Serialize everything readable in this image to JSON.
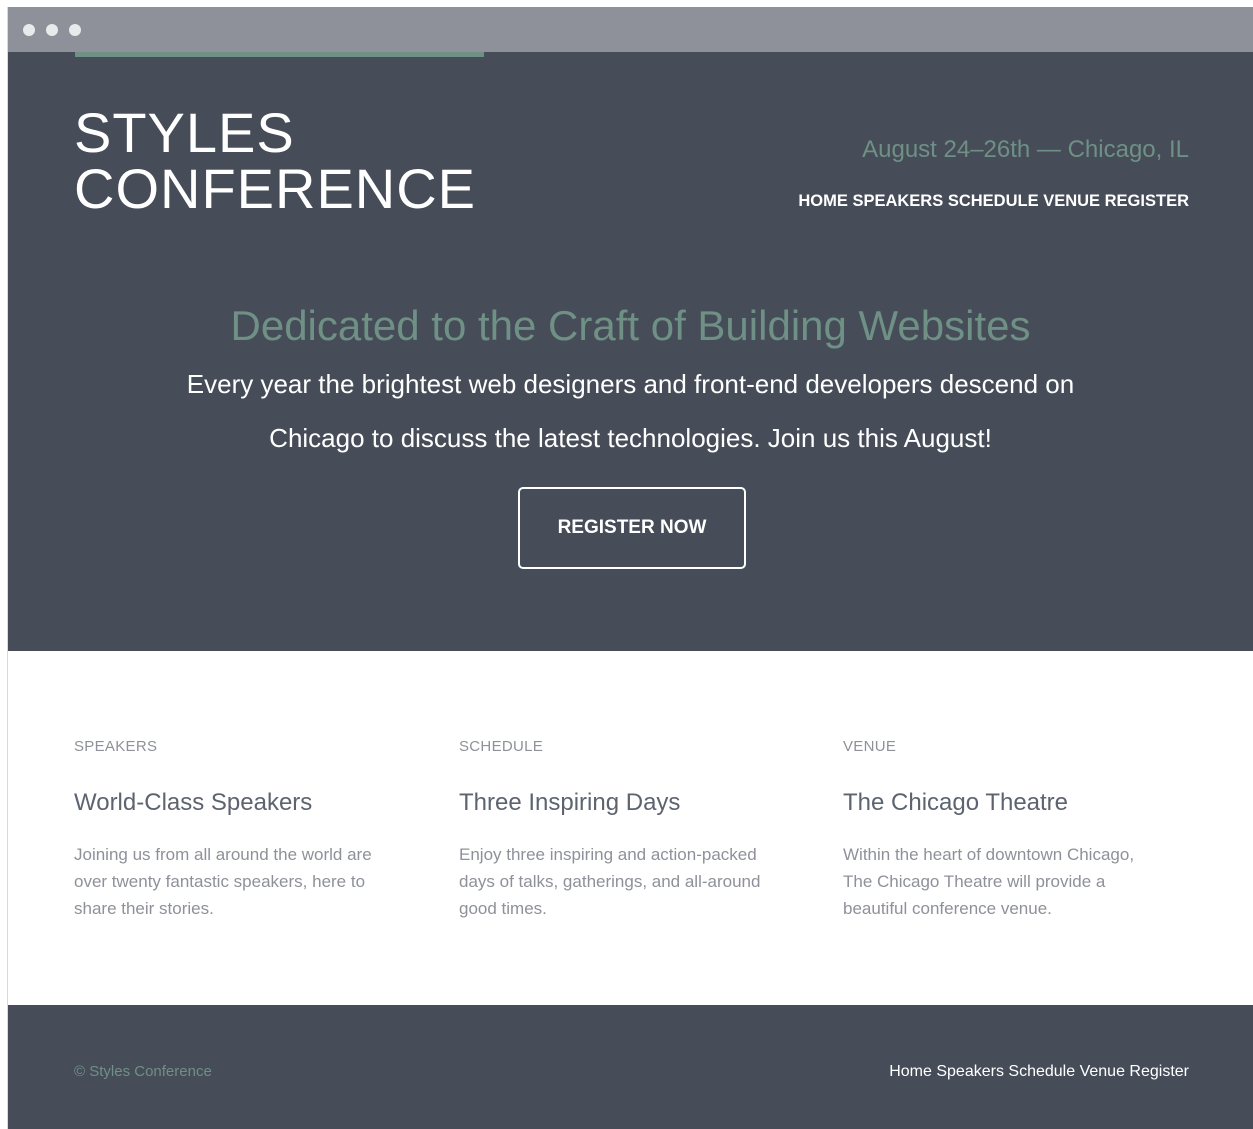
{
  "header": {
    "logo_line1": "STYLES",
    "logo_line2": "CONFERENCE",
    "tagline": "August 24–26th — Chicago, IL",
    "nav": [
      "HOME",
      "SPEAKERS",
      "SCHEDULE",
      "VENUE",
      "REGISTER"
    ]
  },
  "hero": {
    "title": "Dedicated to the Craft of Building Websites",
    "text_line1": "Every year the brightest web designers and front-end developers descend on",
    "text_line2": "Chicago to discuss the latest technologies. Join us this August!",
    "cta_label": "REGISTER NOW"
  },
  "features": [
    {
      "label": "SPEAKERS",
      "heading": "World-Class Speakers",
      "body": [
        "Joining us from all around the world are",
        "over twenty fantastic speakers, here to",
        "share their stories."
      ]
    },
    {
      "label": "SCHEDULE",
      "heading": "Three Inspiring Days",
      "body": [
        "Enjoy three inspiring and action-packed",
        "days of talks, gatherings, and all-around",
        "good times."
      ]
    },
    {
      "label": "VENUE",
      "heading": "The Chicago Theatre",
      "body": [
        "Within the heart of downtown Chicago,",
        "The Chicago Theatre will provide a",
        "beautiful conference venue."
      ]
    }
  ],
  "footer": {
    "copyright": "© Styles Conference",
    "nav": [
      "Home",
      "Speakers",
      "Schedule",
      "Venue",
      "Register"
    ]
  },
  "colors": {
    "dark_bg": "#464d59",
    "accent": "#6f9085",
    "titlebar": "#8e9199",
    "muted_text": "#8e9199"
  },
  "icons": [
    "window-control-dot"
  ]
}
